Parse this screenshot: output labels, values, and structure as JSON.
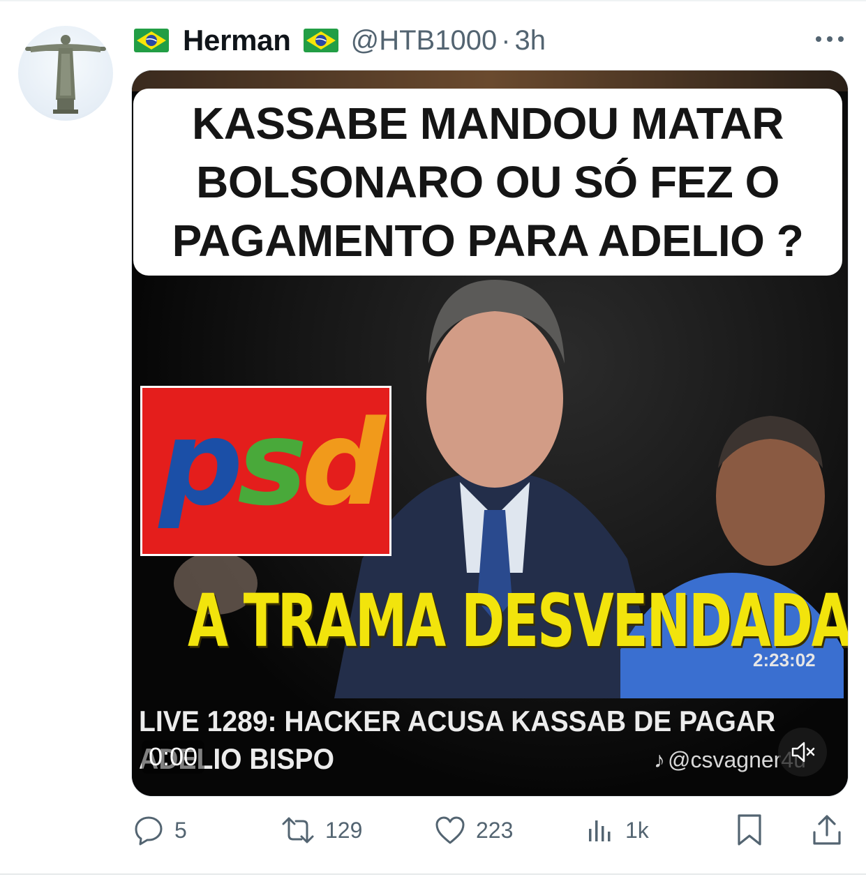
{
  "tweet": {
    "display_name": "Herman",
    "handle": "@HTB1000",
    "separator": "·",
    "time": "3h",
    "author_flag_icon": "brazil-flag-icon",
    "avatar_icon": "christ-the-redeemer-statue-icon"
  },
  "media": {
    "headline": [
      "KASSABE MANDOU MATAR",
      "BOLSONARO OU SÓ FEZ O",
      "PAGAMENTO PARA ADELIO ?"
    ],
    "logo_text": {
      "p": "p",
      "s": "s",
      "d": "d"
    },
    "overlay_title": "A TRAMA DESVENDADA ?",
    "video_duration_label": "2:23:02",
    "live_title": [
      "LIVE 1289: HACKER ACUSA KASSAB DE PAGAR",
      "ADELIO BISPO"
    ],
    "watermark": "@csvagner4u",
    "playback_time": "0:00"
  },
  "actions": {
    "replies": "5",
    "reposts": "129",
    "likes": "223",
    "views": "1k"
  },
  "colors": {
    "text_primary": "#0f1419",
    "text_secondary": "#536471",
    "psd_red": "#e41e1c",
    "psd_blue": "#1b4fa7",
    "psd_green": "#49a93a",
    "psd_orange": "#f19a1b",
    "trama_yellow": "#f2e40c"
  }
}
